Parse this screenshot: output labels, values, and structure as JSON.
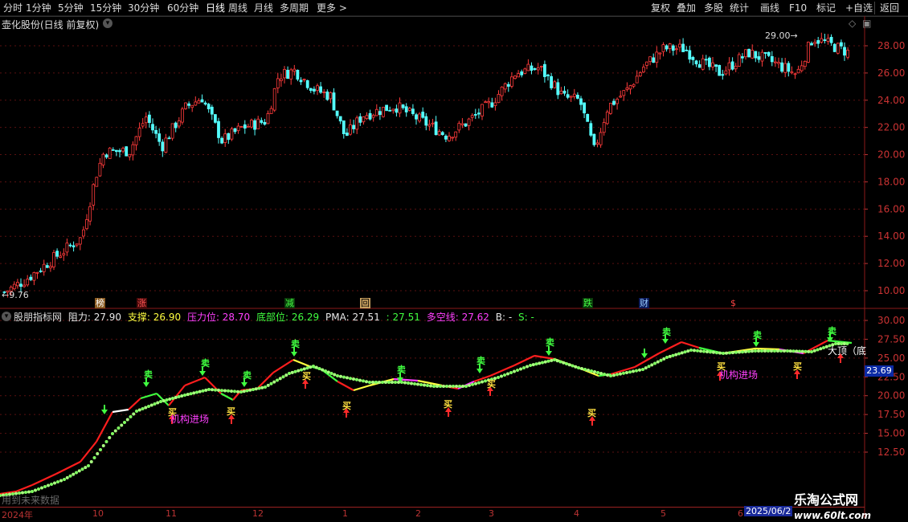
{
  "toolbar": {
    "periods": [
      "分时",
      "1分钟",
      "5分钟",
      "15分钟",
      "30分钟",
      "60分钟",
      "日线",
      "周线",
      "月线",
      "多周期",
      "更多 >"
    ],
    "active": "日线",
    "actions": [
      "复权",
      "叠加",
      "多股",
      "统计",
      "画线",
      "F10",
      "标记",
      "+自选",
      "返回"
    ]
  },
  "main": {
    "title": "壶化股份(日线 前复权)",
    "high_label": "29.00",
    "low_label": "9.76",
    "y_ticks": [
      "28.00",
      "26.00",
      "24.00",
      "22.00",
      "20.00",
      "18.00",
      "16.00",
      "14.00",
      "12.00",
      "10.00"
    ],
    "event_tags": [
      "榜",
      "涨",
      "减",
      "回",
      "跌",
      "财",
      "$"
    ]
  },
  "indicator": {
    "name": "股朋指标网",
    "legend": [
      {
        "label": "阻力: 27.90",
        "color": "#e8e8e8"
      },
      {
        "label": "支撑: 26.90",
        "color": "#ffff40"
      },
      {
        "label": "压力位: 28.70",
        "color": "#ff40ff"
      },
      {
        "label": "底部位: 26.29",
        "color": "#40ff40"
      },
      {
        "label": "PMA: 27.51",
        "color": "#e8e8e8"
      },
      {
        "label": ": 27.51",
        "color": "#40ff40"
      },
      {
        "label": "多空线: 27.62",
        "color": "#ff40ff"
      },
      {
        "label": "B: -",
        "color": "#e8e8e8"
      },
      {
        "label": "S: -",
        "color": "#40ff40"
      }
    ],
    "y_ticks": [
      "30.00",
      "27.50",
      "25.00",
      "22.50",
      "20.00",
      "17.50",
      "15.00",
      "12.50"
    ],
    "current_price": "23.69",
    "sell_label": "卖",
    "buy_label": "买",
    "inst_label": "机构进场",
    "top_label": "大顶（底"
  },
  "footer": {
    "future_note": "用到未来数据",
    "dates": [
      "2024年",
      "10",
      "11",
      "12",
      "1",
      "2",
      "3",
      "4",
      "5",
      "6"
    ],
    "date_box": "2025/06/2"
  },
  "watermark": {
    "title": "乐淘公式网",
    "url": "www.60lt.com"
  }
}
